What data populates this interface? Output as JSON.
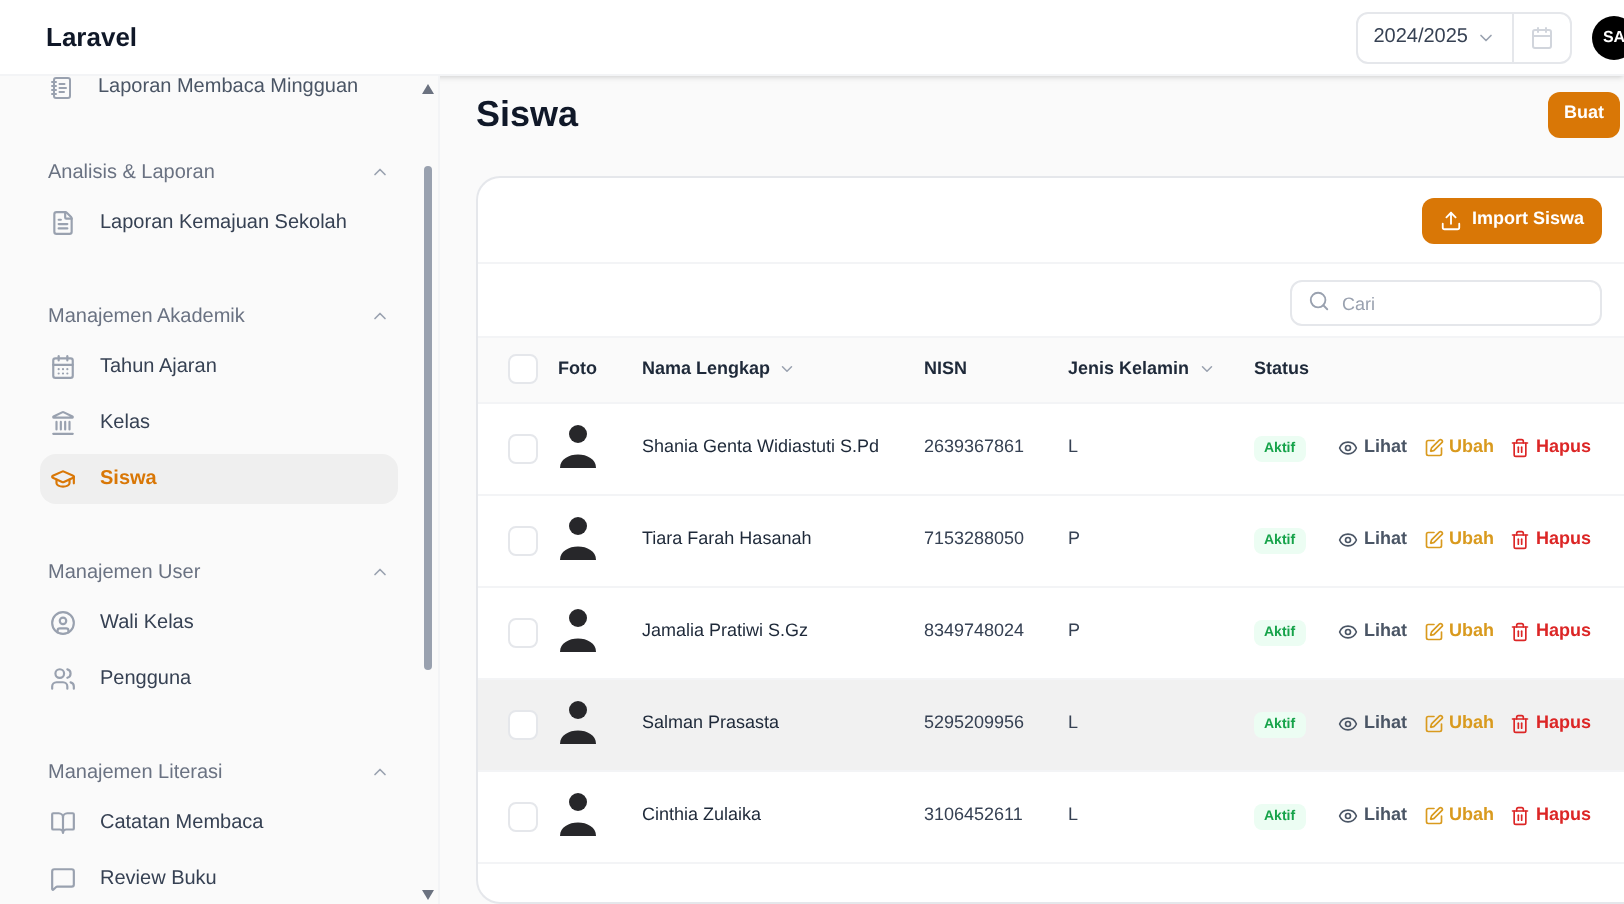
{
  "header": {
    "brand": "Laravel",
    "year_select": {
      "value": "2024/2025"
    },
    "avatar": {
      "initials": "SA"
    }
  },
  "sidebar": {
    "top_item": {
      "label": "Laporan Membaca Mingguan"
    },
    "groups": [
      {
        "label": "Analisis & Laporan",
        "expanded": true,
        "items": [
          {
            "label": "Laporan Kemajuan Sekolah",
            "selected": false
          }
        ]
      },
      {
        "label": "Manajemen Akademik",
        "expanded": true,
        "items": [
          {
            "label": "Tahun Ajaran",
            "selected": false
          },
          {
            "label": "Kelas",
            "selected": false
          },
          {
            "label": "Siswa",
            "selected": true
          }
        ]
      },
      {
        "label": "Manajemen User",
        "expanded": true,
        "items": [
          {
            "label": "Wali Kelas",
            "selected": false
          },
          {
            "label": "Pengguna",
            "selected": false
          }
        ]
      },
      {
        "label": "Manajemen Literasi",
        "expanded": true,
        "items": [
          {
            "label": "Catatan Membaca",
            "selected": false
          },
          {
            "label": "Review Buku",
            "selected": false
          }
        ]
      }
    ]
  },
  "page": {
    "title": "Siswa",
    "create_button": "Buat"
  },
  "table": {
    "import_button": "Import Siswa",
    "select_all_checked": false,
    "search": {
      "placeholder": "Cari"
    },
    "columns": [
      {
        "label": "Foto",
        "sortable": false
      },
      {
        "label": "Nama Lengkap",
        "sortable": true
      },
      {
        "label": "NISN",
        "sortable": false
      },
      {
        "label": "Jenis Kelamin",
        "sortable": true
      },
      {
        "label": "Status",
        "sortable": false
      }
    ],
    "rows": [
      {
        "checked": false,
        "hovered": false,
        "name": "Shania Genta Widiastuti S.Pd",
        "nisn": "2639367861",
        "gender": "L",
        "status": "Aktif",
        "actions": [
          {
            "kind": "view",
            "label": "Lihat"
          },
          {
            "kind": "edit",
            "label": "Ubah"
          },
          {
            "kind": "delete",
            "label": "Hapus"
          }
        ]
      },
      {
        "checked": false,
        "hovered": false,
        "name": "Tiara Farah Hasanah",
        "nisn": "7153288050",
        "gender": "P",
        "status": "Aktif",
        "actions": [
          {
            "kind": "view",
            "label": "Lihat"
          },
          {
            "kind": "edit",
            "label": "Ubah"
          },
          {
            "kind": "delete",
            "label": "Hapus"
          }
        ]
      },
      {
        "checked": false,
        "hovered": false,
        "name": "Jamalia Pratiwi S.Gz",
        "nisn": "8349748024",
        "gender": "P",
        "status": "Aktif",
        "actions": [
          {
            "kind": "view",
            "label": "Lihat"
          },
          {
            "kind": "edit",
            "label": "Ubah"
          },
          {
            "kind": "delete",
            "label": "Hapus"
          }
        ]
      },
      {
        "checked": false,
        "hovered": true,
        "name": "Salman Prasasta",
        "nisn": "5295209956",
        "gender": "L",
        "status": "Aktif",
        "actions": [
          {
            "kind": "view",
            "label": "Lihat"
          },
          {
            "kind": "edit",
            "label": "Ubah"
          },
          {
            "kind": "delete",
            "label": "Hapus"
          }
        ]
      },
      {
        "checked": false,
        "hovered": false,
        "name": "Cinthia Zulaika",
        "nisn": "3106452611",
        "gender": "L",
        "status": "Aktif",
        "actions": [
          {
            "kind": "view",
            "label": "Lihat"
          },
          {
            "kind": "edit",
            "label": "Ubah"
          },
          {
            "kind": "delete",
            "label": "Hapus"
          }
        ]
      }
    ]
  }
}
